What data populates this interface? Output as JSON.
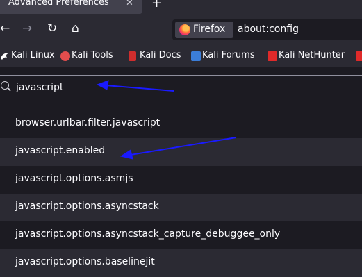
{
  "tab": {
    "title": "Advanced Preferences",
    "close_glyph": "✕",
    "new_tab_glyph": "+"
  },
  "nav": {
    "back_glyph": "←",
    "forward_glyph": "→",
    "reload_glyph": "↻",
    "home_glyph": "⌂",
    "identity_label": "Firefox",
    "url": "about:config"
  },
  "bookmarks": [
    {
      "label": "Kali Linux",
      "icon": "kali-dragon-icon",
      "color": "#ffffff"
    },
    {
      "label": "Kali Tools",
      "icon": "kali-tools-icon",
      "color": "#e34d4d"
    },
    {
      "label": "Kali Docs",
      "icon": "kali-docs-icon",
      "color": "#cf2d2d"
    },
    {
      "label": "Kali Forums",
      "icon": "kali-forums-icon",
      "color": "#3b7dd8"
    },
    {
      "label": "Kali NetHunter",
      "icon": "nethunter-icon",
      "color": "#e02a2a"
    }
  ],
  "search": {
    "value": "javascript"
  },
  "prefs": [
    {
      "name": "browser.urlbar.filter.javascript"
    },
    {
      "name": "javascript.enabled"
    },
    {
      "name": "javascript.options.asmjs"
    },
    {
      "name": "javascript.options.asyncstack"
    },
    {
      "name": "javascript.options.asyncstack_capture_debuggee_only"
    },
    {
      "name": "javascript.options.baselinejit"
    }
  ],
  "colors": {
    "annotation_arrow": "#1a1aff",
    "accent": "#ff7139"
  }
}
